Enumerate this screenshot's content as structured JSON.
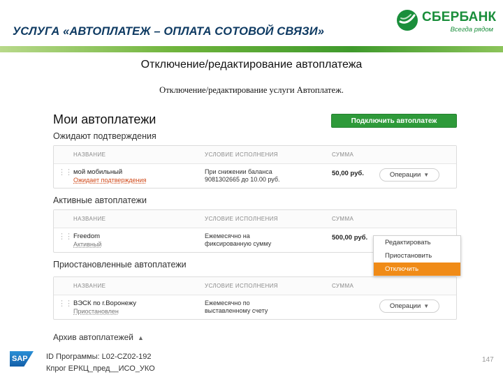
{
  "header": {
    "title": "УСЛУГА «АВТОПЛАТЕЖ – ОПЛАТА СОТОВОЙ СВЯЗИ»",
    "subtitle": "Отключение/редактирование автоплатежа",
    "caption": "Отключение/редактирование услуги Автоплатеж.",
    "logo_text": "СБЕРБАНК",
    "logo_slogan": "Всегда рядом",
    "brand_color": "#1a8e3b"
  },
  "app": {
    "title": "Мои автоплатежи",
    "connect_button": "Подключить автоплатеж",
    "columns": {
      "name": "НАЗВАНИЕ",
      "condition": "УСЛОВИЕ ИСПОЛНЕНИЯ",
      "sum": "СУММА"
    },
    "operations_label": "Операции",
    "sections": [
      {
        "heading": "Ожидают подтверждения",
        "row": {
          "name": "мой мобильный",
          "status": "Ожидает подтверждения",
          "condition_line1": "При снижении баланса",
          "condition_line2": "9081302665 до 10.00 руб.",
          "sum": "50,00 руб."
        }
      },
      {
        "heading": "Активные автоплатежи",
        "row": {
          "name": "Freedom",
          "status": "Активный",
          "condition_line1": "Ежемесячно на",
          "condition_line2": "фиксированную сумму",
          "sum": "500,00 руб."
        }
      },
      {
        "heading": "Приостановленные автоплатежи",
        "row": {
          "name": "ВЭСК по г.Воронежу",
          "status": "Приостановлен",
          "condition_line1": "Ежемесячно по",
          "condition_line2": "выставленному счету",
          "sum": ""
        }
      }
    ],
    "dropdown": {
      "items": [
        "Редактировать",
        "Приостановить",
        "Отключить"
      ],
      "active_index": 2,
      "active_color": "#f08b17"
    },
    "archive_label": "Архив автоплатежей"
  },
  "footer": {
    "sap_logo": "SAP",
    "line1": "ID Программы:  L02-CZ02-192",
    "line2": "Кпрог ЕРКЦ_пред__ИСО_УКО",
    "page_number": "147"
  }
}
